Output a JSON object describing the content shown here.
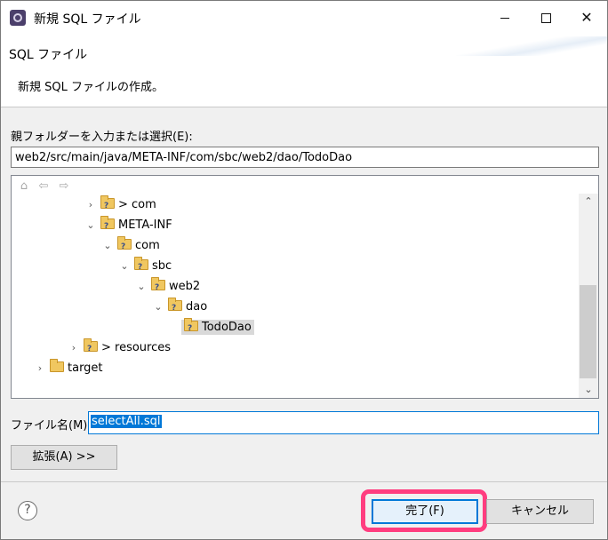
{
  "window": {
    "title": "新規 SQL ファイル",
    "controls": {
      "minimize": "minimize",
      "maximize": "maximize",
      "close": "✕"
    }
  },
  "header": {
    "heading": "SQL ファイル",
    "description": "新規 SQL ファイルの作成。"
  },
  "parent_folder": {
    "label": "親フォルダーを入力または選択(E):",
    "value": "web2/src/main/java/META-INF/com/sbc/web2/dao/TodoDao"
  },
  "tree": {
    "toolbar_icons": [
      "home-icon",
      "back-arrow-icon",
      "forward-arrow-icon"
    ],
    "items": [
      {
        "label": "> com",
        "twisty": "›",
        "folder": "package"
      },
      {
        "label": "META-INF",
        "twisty": "⌄",
        "folder": "package"
      },
      {
        "label": "com",
        "twisty": "⌄",
        "folder": "package"
      },
      {
        "label": "sbc",
        "twisty": "⌄",
        "folder": "package"
      },
      {
        "label": "web2",
        "twisty": "⌄",
        "folder": "package"
      },
      {
        "label": "dao",
        "twisty": "⌄",
        "folder": "package"
      },
      {
        "label": "TodoDao",
        "twisty": "",
        "folder": "package",
        "selected": true
      },
      {
        "label": "> resources",
        "twisty": "›",
        "folder": "package"
      },
      {
        "label": "target",
        "twisty": "›",
        "folder": "folder"
      }
    ]
  },
  "file_name": {
    "label": "ファイル名(M):",
    "value": "selectAll.sql"
  },
  "buttons": {
    "advanced": "拡張(A) >>",
    "help": "?",
    "finish": "完了(F)",
    "cancel": "キャンセル"
  },
  "colors": {
    "accent": "#0078d7",
    "highlight": "#ff3d7f",
    "folder": "#f0c760"
  }
}
